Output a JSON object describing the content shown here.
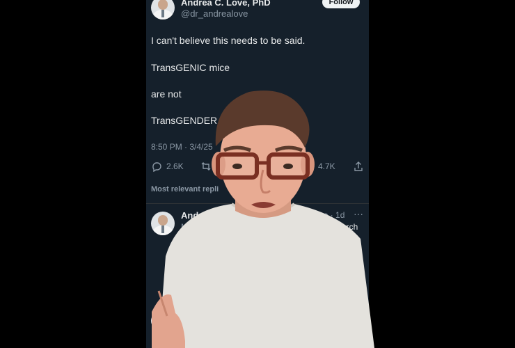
{
  "post": {
    "author": "Andrea C. Love, PhD",
    "handle": "@dr_andrealove",
    "follow_label": "Follow",
    "lines": [
      "I can't believe this needs to be said.",
      "TransGENIC mice",
      "are not",
      "TransGENDER"
    ],
    "timestamp": "8:50 PM · 3/4/25",
    "replies_count": "2.6K",
    "bookmarks_count": "4.7K"
  },
  "replies_section": {
    "label": "Most relevant repli",
    "reply": {
      "author": "Andrea C. L",
      "handle_time": "ealove · 1d",
      "text_start": "More",
      "text_end": "arch"
    }
  },
  "colors": {
    "background": "#000000",
    "panel": "#15202b",
    "text": "#e7e9ea",
    "muted": "#8b98a5"
  },
  "icons": [
    "reply-icon",
    "repost-icon",
    "bookmark-icon",
    "share-icon",
    "more-icon",
    "mail-icon"
  ]
}
